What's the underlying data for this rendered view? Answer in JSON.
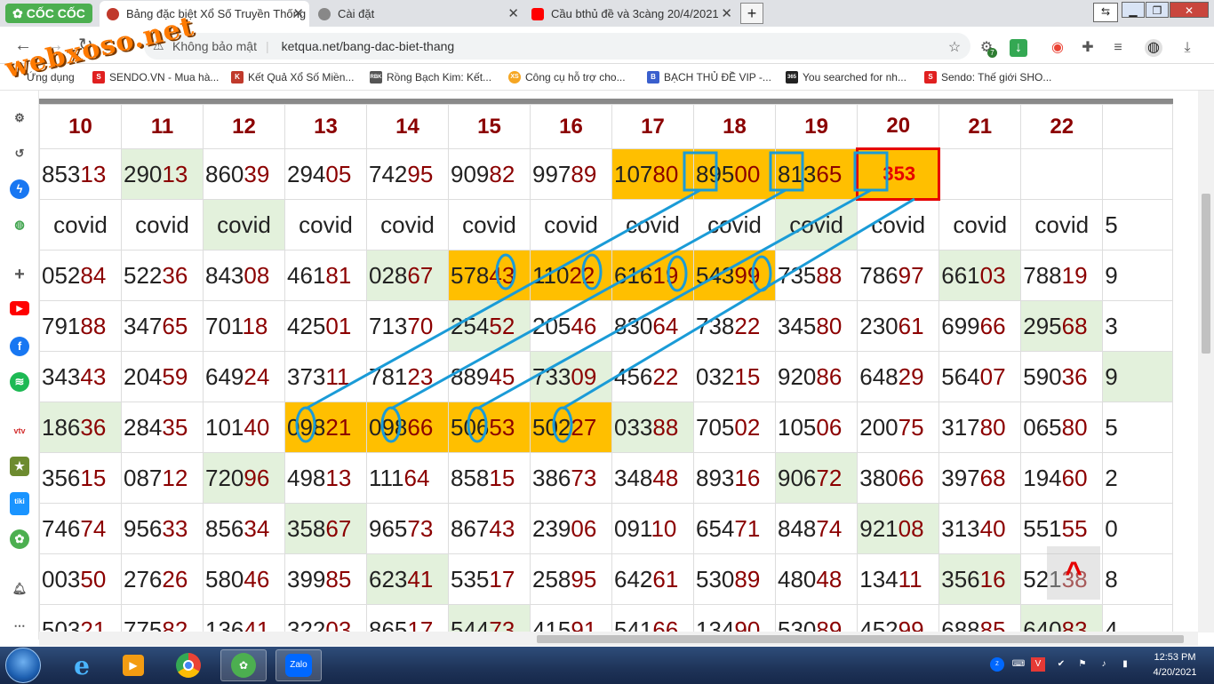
{
  "browser": {
    "app_name": "CỐC CỐC",
    "tabs": [
      {
        "title": "Bảng đặc biệt Xổ Số Truyền Thống",
        "active": true
      },
      {
        "title": "Cài đặt",
        "active": false
      },
      {
        "title": "Cầu bthủ đề và 3càng 20/4/2021",
        "active": false
      }
    ],
    "new_tab": "+",
    "security_label": "Không bảo mật",
    "url": "ketqua.net/bang-dac-biet-thang",
    "extension_badge": "7"
  },
  "watermark": "webxoso.net",
  "bookmarks": [
    {
      "label": "Ứng dụng",
      "color": "#4285f4",
      "glyph": ""
    },
    {
      "label": "SENDO.VN - Mua hà...",
      "color": "#e02020",
      "glyph": "S"
    },
    {
      "label": "Kết Quả Xổ Số Miền...",
      "color": "#c0392b",
      "glyph": "K"
    },
    {
      "label": "Rồng Bạch Kim: Kết...",
      "color": "#555555",
      "glyph": "RBK"
    },
    {
      "label": "Công cụ hỗ trợ cho...",
      "color": "#f5a623",
      "glyph": "XS"
    },
    {
      "label": "BẠCH THỦ ĐỀ VIP -...",
      "color": "#3a5fcd",
      "glyph": "B"
    },
    {
      "label": "You searched for nh...",
      "color": "#222222",
      "glyph": "365"
    },
    {
      "label": "Sendo: Thế giới SHO...",
      "color": "#e02020",
      "glyph": "S"
    }
  ],
  "sidebar_icons": [
    "settings-icon",
    "history-icon",
    "messenger-icon",
    "games-icon",
    "add-icon",
    "youtube-icon",
    "facebook-icon",
    "spotify-icon",
    "vtv-icon",
    "game-app-icon",
    "tiki-icon",
    "coccoc-icon",
    "notification-icon",
    "more-icon"
  ],
  "table": {
    "headers": [
      "10",
      "11",
      "12",
      "13",
      "14",
      "15",
      "16",
      "17",
      "18",
      "19",
      "20",
      "21",
      "22",
      ""
    ],
    "rows": [
      [
        {
          "v": "85313"
        },
        {
          "v": "29013",
          "g": 1
        },
        {
          "v": "86039"
        },
        {
          "v": "29405"
        },
        {
          "v": "74295"
        },
        {
          "v": "90982"
        },
        {
          "v": "99789"
        },
        {
          "v": "10780",
          "o": 1
        },
        {
          "v": "89500",
          "o": 1
        },
        {
          "v": "81365",
          "o": 1
        },
        {
          "v": "353",
          "red": 1
        },
        {
          "v": ""
        },
        {
          "v": ""
        },
        {
          "v": ""
        }
      ],
      [
        {
          "v": "covid",
          "c": 1
        },
        {
          "v": "covid",
          "c": 1
        },
        {
          "v": "covid",
          "c": 1,
          "g": 1
        },
        {
          "v": "covid",
          "c": 1
        },
        {
          "v": "covid",
          "c": 1
        },
        {
          "v": "covid",
          "c": 1
        },
        {
          "v": "covid",
          "c": 1
        },
        {
          "v": "covid",
          "c": 1
        },
        {
          "v": "covid",
          "c": 1
        },
        {
          "v": "covid",
          "c": 1,
          "g": 1
        },
        {
          "v": "covid",
          "c": 1
        },
        {
          "v": "covid",
          "c": 1
        },
        {
          "v": "covid",
          "c": 1
        },
        {
          "v": "5"
        }
      ],
      [
        {
          "v": "05284"
        },
        {
          "v": "52236"
        },
        {
          "v": "84308"
        },
        {
          "v": "46181"
        },
        {
          "v": "02867",
          "g": 1
        },
        {
          "v": "57843",
          "o": 1
        },
        {
          "v": "11022",
          "o": 1
        },
        {
          "v": "61619",
          "o": 1
        },
        {
          "v": "54399",
          "o": 1
        },
        {
          "v": "73588"
        },
        {
          "v": "78697"
        },
        {
          "v": "66103",
          "g": 1
        },
        {
          "v": "78819"
        },
        {
          "v": "9"
        }
      ],
      [
        {
          "v": "79188"
        },
        {
          "v": "34765"
        },
        {
          "v": "70118"
        },
        {
          "v": "42501"
        },
        {
          "v": "71370"
        },
        {
          "v": "25452",
          "g": 1
        },
        {
          "v": "20546"
        },
        {
          "v": "83064"
        },
        {
          "v": "73822"
        },
        {
          "v": "34580"
        },
        {
          "v": "23061"
        },
        {
          "v": "69966"
        },
        {
          "v": "29568",
          "g": 1
        },
        {
          "v": "3"
        }
      ],
      [
        {
          "v": "34343"
        },
        {
          "v": "20459"
        },
        {
          "v": "64924"
        },
        {
          "v": "37311"
        },
        {
          "v": "78123"
        },
        {
          "v": "88945"
        },
        {
          "v": "73309",
          "g": 1
        },
        {
          "v": "45622"
        },
        {
          "v": "03215"
        },
        {
          "v": "92086"
        },
        {
          "v": "64829"
        },
        {
          "v": "56407"
        },
        {
          "v": "59036"
        },
        {
          "v": "9",
          "g": 1
        }
      ],
      [
        {
          "v": "18636",
          "g": 1
        },
        {
          "v": "28435"
        },
        {
          "v": "10140"
        },
        {
          "v": "09821",
          "o": 1
        },
        {
          "v": "09866",
          "o": 1
        },
        {
          "v": "50653",
          "o": 1
        },
        {
          "v": "50227",
          "o": 1
        },
        {
          "v": "03388",
          "g": 1
        },
        {
          "v": "70502"
        },
        {
          "v": "10506"
        },
        {
          "v": "20075"
        },
        {
          "v": "31780"
        },
        {
          "v": "06580"
        },
        {
          "v": "5"
        }
      ],
      [
        {
          "v": "35615"
        },
        {
          "v": "08712"
        },
        {
          "v": "72096",
          "g": 1
        },
        {
          "v": "49813"
        },
        {
          "v": "11164"
        },
        {
          "v": "85815"
        },
        {
          "v": "38673"
        },
        {
          "v": "34848"
        },
        {
          "v": "89316"
        },
        {
          "v": "90672",
          "g": 1
        },
        {
          "v": "38066"
        },
        {
          "v": "39768"
        },
        {
          "v": "19460"
        },
        {
          "v": "2"
        }
      ],
      [
        {
          "v": "74674"
        },
        {
          "v": "95633"
        },
        {
          "v": "85634"
        },
        {
          "v": "35867",
          "g": 1
        },
        {
          "v": "96573"
        },
        {
          "v": "86743"
        },
        {
          "v": "23906"
        },
        {
          "v": "09110"
        },
        {
          "v": "65471"
        },
        {
          "v": "84874"
        },
        {
          "v": "92108",
          "g": 1
        },
        {
          "v": "31340"
        },
        {
          "v": "55155"
        },
        {
          "v": "0"
        }
      ],
      [
        {
          "v": "00350"
        },
        {
          "v": "27626"
        },
        {
          "v": "58046"
        },
        {
          "v": "39985"
        },
        {
          "v": "62341",
          "g": 1
        },
        {
          "v": "53517"
        },
        {
          "v": "25895"
        },
        {
          "v": "64261"
        },
        {
          "v": "53089"
        },
        {
          "v": "48048"
        },
        {
          "v": "13411"
        },
        {
          "v": "35616",
          "g": 1
        },
        {
          "v": "52138"
        },
        {
          "v": "8"
        }
      ],
      [
        {
          "v": "50321"
        },
        {
          "v": "77582"
        },
        {
          "v": "13641"
        },
        {
          "v": "32203"
        },
        {
          "v": "86517"
        },
        {
          "v": "54473",
          "g": 1
        },
        {
          "v": "41591"
        },
        {
          "v": "54166"
        },
        {
          "v": "13490"
        },
        {
          "v": "53089"
        },
        {
          "v": "45299"
        },
        {
          "v": "68885"
        },
        {
          "v": "64083",
          "g": 1
        },
        {
          "v": "4"
        }
      ]
    ]
  },
  "scroll_top_icon": "chevron-up-icon",
  "taskbar": {
    "apps": [
      "ie-icon",
      "media-player-icon",
      "chrome-icon",
      "coccoc-icon",
      "zalo-icon"
    ],
    "zalo_label": "Zalo",
    "time": "12:53 PM",
    "date": "4/20/2021"
  },
  "colors": {
    "accent_orange": "#ffbf00",
    "highlight_green": "#e3f1dc",
    "digit_red": "#8b0000",
    "mark_blue": "#1a9bd7",
    "alert_red": "#e60000"
  }
}
